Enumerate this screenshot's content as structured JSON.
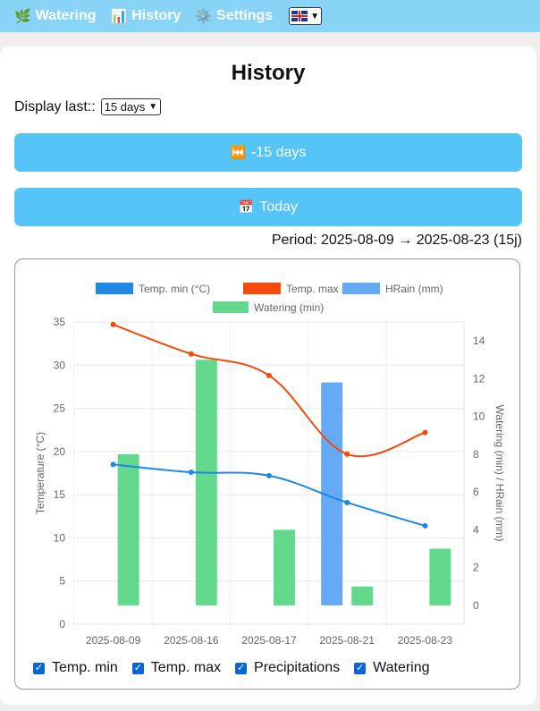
{
  "nav": {
    "items": [
      {
        "icon": "🌿",
        "icon_name": "leaf-icon",
        "label": "Watering"
      },
      {
        "icon": "📊",
        "icon_name": "bar-chart-icon",
        "label": "History"
      },
      {
        "icon": "⚙️",
        "icon_name": "gear-icon",
        "label": "Settings"
      }
    ],
    "language_icon": "uk-flag-icon"
  },
  "page": {
    "title": "History",
    "display_label": "Display last::",
    "range_value": "15 days",
    "back_button": {
      "icon": "⏮️",
      "label": "-15 days"
    },
    "today_button": {
      "icon": "📅",
      "label": "Today"
    },
    "period": "Period: 2025-08-09 → 2025-08-23 (15j)"
  },
  "colors": {
    "nav_bg": "#87d4f7",
    "button_bg": "#55c4f6",
    "temp_min": "#1e88e5",
    "temp_max": "#f44a0b",
    "rain": "#64aaf5",
    "watering": "#62d98d"
  },
  "toggles": [
    {
      "label": "Temp. min",
      "checked": true
    },
    {
      "label": "Temp. max",
      "checked": true
    },
    {
      "label": "Precipitations",
      "checked": true
    },
    {
      "label": "Watering",
      "checked": true
    }
  ],
  "chart_data": {
    "type": "bar",
    "categories": [
      "2025-08-09",
      "2025-08-16",
      "2025-08-17",
      "2025-08-21",
      "2025-08-23"
    ],
    "legend": [
      "Temp. min (°C)",
      "Temp. max (°C)",
      "HRain (mm)",
      "Watering (min)"
    ],
    "legend_position": "top",
    "series": [
      {
        "name": "Temp. min (°C)",
        "type": "line",
        "axis": "left",
        "values": [
          18.5,
          17.6,
          17.2,
          14.1,
          11.4
        ]
      },
      {
        "name": "Temp. max (°C)",
        "type": "line",
        "axis": "left",
        "values": [
          34.7,
          31.3,
          28.8,
          19.7,
          22.2
        ]
      },
      {
        "name": "HRain (mm)",
        "type": "bar",
        "axis": "right",
        "values": [
          0,
          0,
          0,
          11.8,
          0
        ]
      },
      {
        "name": "Watering (min)",
        "type": "bar",
        "axis": "right",
        "values": [
          8,
          13,
          4,
          1,
          3
        ]
      }
    ],
    "ylabel": "Temperature (°C)",
    "y2label": "Watering (min) / HRain (mm)",
    "ylim": [
      0,
      35
    ],
    "y_ticks": [
      0,
      5,
      10,
      15,
      20,
      25,
      30,
      35
    ],
    "y2lim": [
      -1,
      15
    ],
    "y2_ticks": [
      0,
      2,
      4,
      6,
      8,
      10,
      12,
      14
    ],
    "grid": true
  }
}
